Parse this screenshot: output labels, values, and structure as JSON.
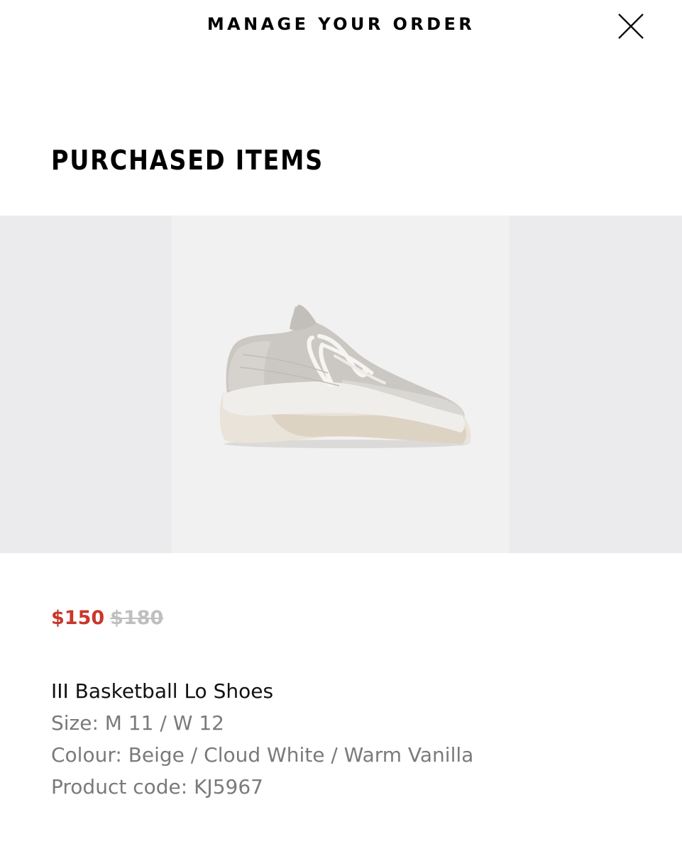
{
  "header": {
    "title": "MANAGE YOUR ORDER",
    "close_icon": "close-icon"
  },
  "section": {
    "title": "PURCHASED ITEMS"
  },
  "item": {
    "image_icon": "sneaker-image",
    "price_sale": "$150",
    "price_original": "$180",
    "name": "III Basketball Lo Shoes",
    "size": "Size: M 11 / W 12",
    "colour": "Colour: Beige / Cloud White / Warm Vanilla",
    "product_code": "Product code: KJ5967"
  },
  "colors": {
    "sale_price": "#c8372b",
    "original_price": "#bfbfbf",
    "detail_text": "#7a7a7a",
    "image_background": "#f2f1f1",
    "strip_background": "#ebebed"
  }
}
